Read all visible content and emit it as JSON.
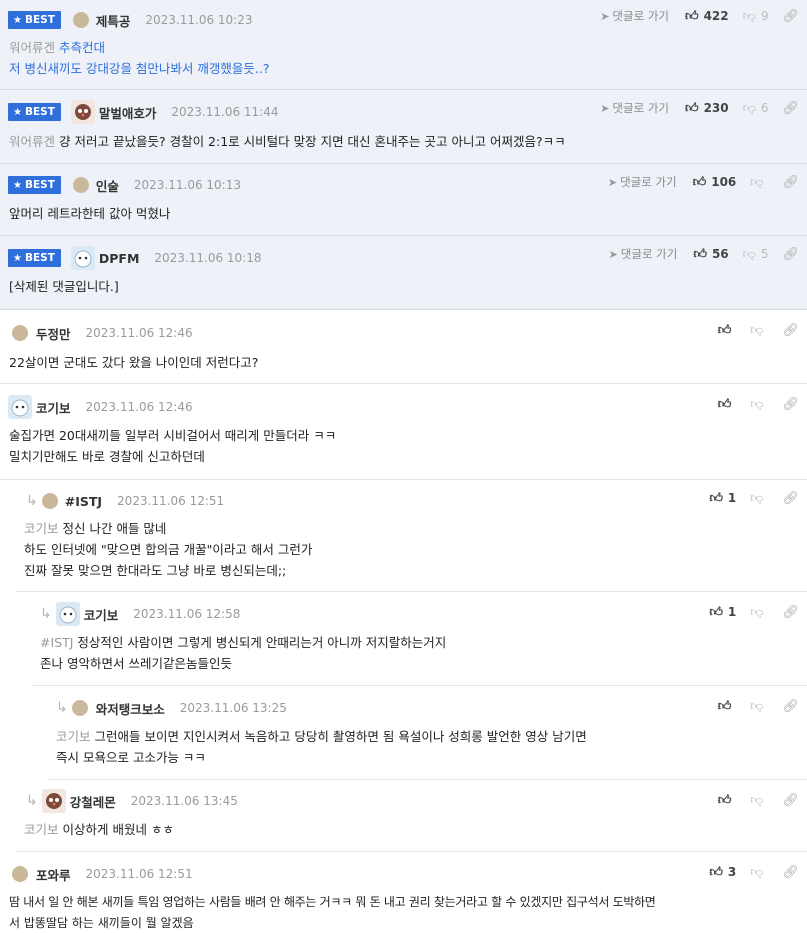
{
  "comments": [
    {
      "best": true,
      "nick": "제특공",
      "date": "2023.11.06 10:23",
      "goto": "댓글로 가기",
      "up": "422",
      "down": "9",
      "mention": "워어류겐",
      "lines": [
        "추측컨대",
        "저 병신새끼도 강대강을 첨만나봐서 깨갱했을듯..?"
      ]
    },
    {
      "best": true,
      "nick": "말벌애호가",
      "date": "2023.11.06 11:44",
      "goto": "댓글로 가기",
      "up": "230",
      "down": "6",
      "mention": "워어류겐",
      "lines": [
        "걍 저러고 끝났을듯? 경찰이 2:1로 시비털다 맞장 지면 대신 혼내주는 곳고 아니고 어쩌겠음?ㅋㅋ"
      ]
    },
    {
      "best": true,
      "nick": "인술",
      "date": "2023.11.06 10:13",
      "goto": "댓글로 가기",
      "up": "106",
      "down": "",
      "lines": [
        "앞머리 레트라한테 값아 먹혔나"
      ]
    },
    {
      "best": true,
      "nick": "DPFM",
      "date": "2023.11.06 10:18",
      "goto": "댓글로 가기",
      "up": "56",
      "down": "5",
      "lines": [
        "[삭제된 댓글입니다.]"
      ]
    },
    {
      "nick": "두정만",
      "date": "2023.11.06 12:46",
      "lines": [
        "22살이면 군대도 갔다 왔을 나이인데 저런다고?"
      ]
    },
    {
      "nick": "코기보",
      "date": "2023.11.06 12:46",
      "lines": [
        "술집가면 20대새끼들 일부러 시비걸어서 때리게 만들더라 ㅋㅋ",
        "밀치기만해도 바로 경찰에 신고하던데"
      ]
    },
    {
      "nick": "#ISTJ",
      "date": "2023.11.06 12:51",
      "up": "1",
      "mention": "코기보",
      "lines": [
        "정신 나간 애들 많네",
        "하도 인터넷에 \"맞으면 합의금 개꿀\"이라고 해서 그런가",
        "진짜 잘못 맞으면 한대라도 그냥 바로 병신되는데;;"
      ]
    },
    {
      "nick": "코기보",
      "date": "2023.11.06 12:58",
      "up": "1",
      "mention": "#ISTJ",
      "lines": [
        "정상적인 사람이면 그렇게 병신되게 안때리는거 아니까 저지랄하는거지",
        "존나 영악하면서 쓰레기같은놈들인듯"
      ]
    },
    {
      "nick": "와저탱크보소",
      "date": "2023.11.06 13:25",
      "mention": "코기보",
      "lines": [
        "그런애들 보이면 지인시켜서 녹음하고 당당히 촬영하면 됨 욕설이나 성희롱 발언한 영상 남기면",
        "즉시 모욕으로 고소가능 ㅋㅋ"
      ]
    },
    {
      "nick": "강철레몬",
      "date": "2023.11.06 13:45",
      "mention": "코기보",
      "lines": [
        "이상하게 배웠네 ㅎㅎ"
      ]
    },
    {
      "nick": "포와루",
      "date": "2023.11.06 12:51",
      "up": "3",
      "lines": [
        "땀 내서 일 안 해본 새끼들 특임 영업하는 사람들 배려 안 해주는 거ㅋㅋ 뭐 돈 내고 권리 찾는거라고 할 수 있겠지만 집구석서 도박하면",
        "서 밥똥딸담 하는 새끼들이 뭘 알겠음"
      ]
    }
  ],
  "labels": {
    "best": "BEST"
  },
  "icons": [
    "star-icon",
    "plane-icon",
    "thumb-up-icon",
    "thumb-down-icon",
    "link-icon",
    "reply-arrow-icon"
  ],
  "colors": {
    "best_badge": "#2f6fdb",
    "best_bg": "#eef2f8",
    "mention": "#9a9a9a"
  }
}
